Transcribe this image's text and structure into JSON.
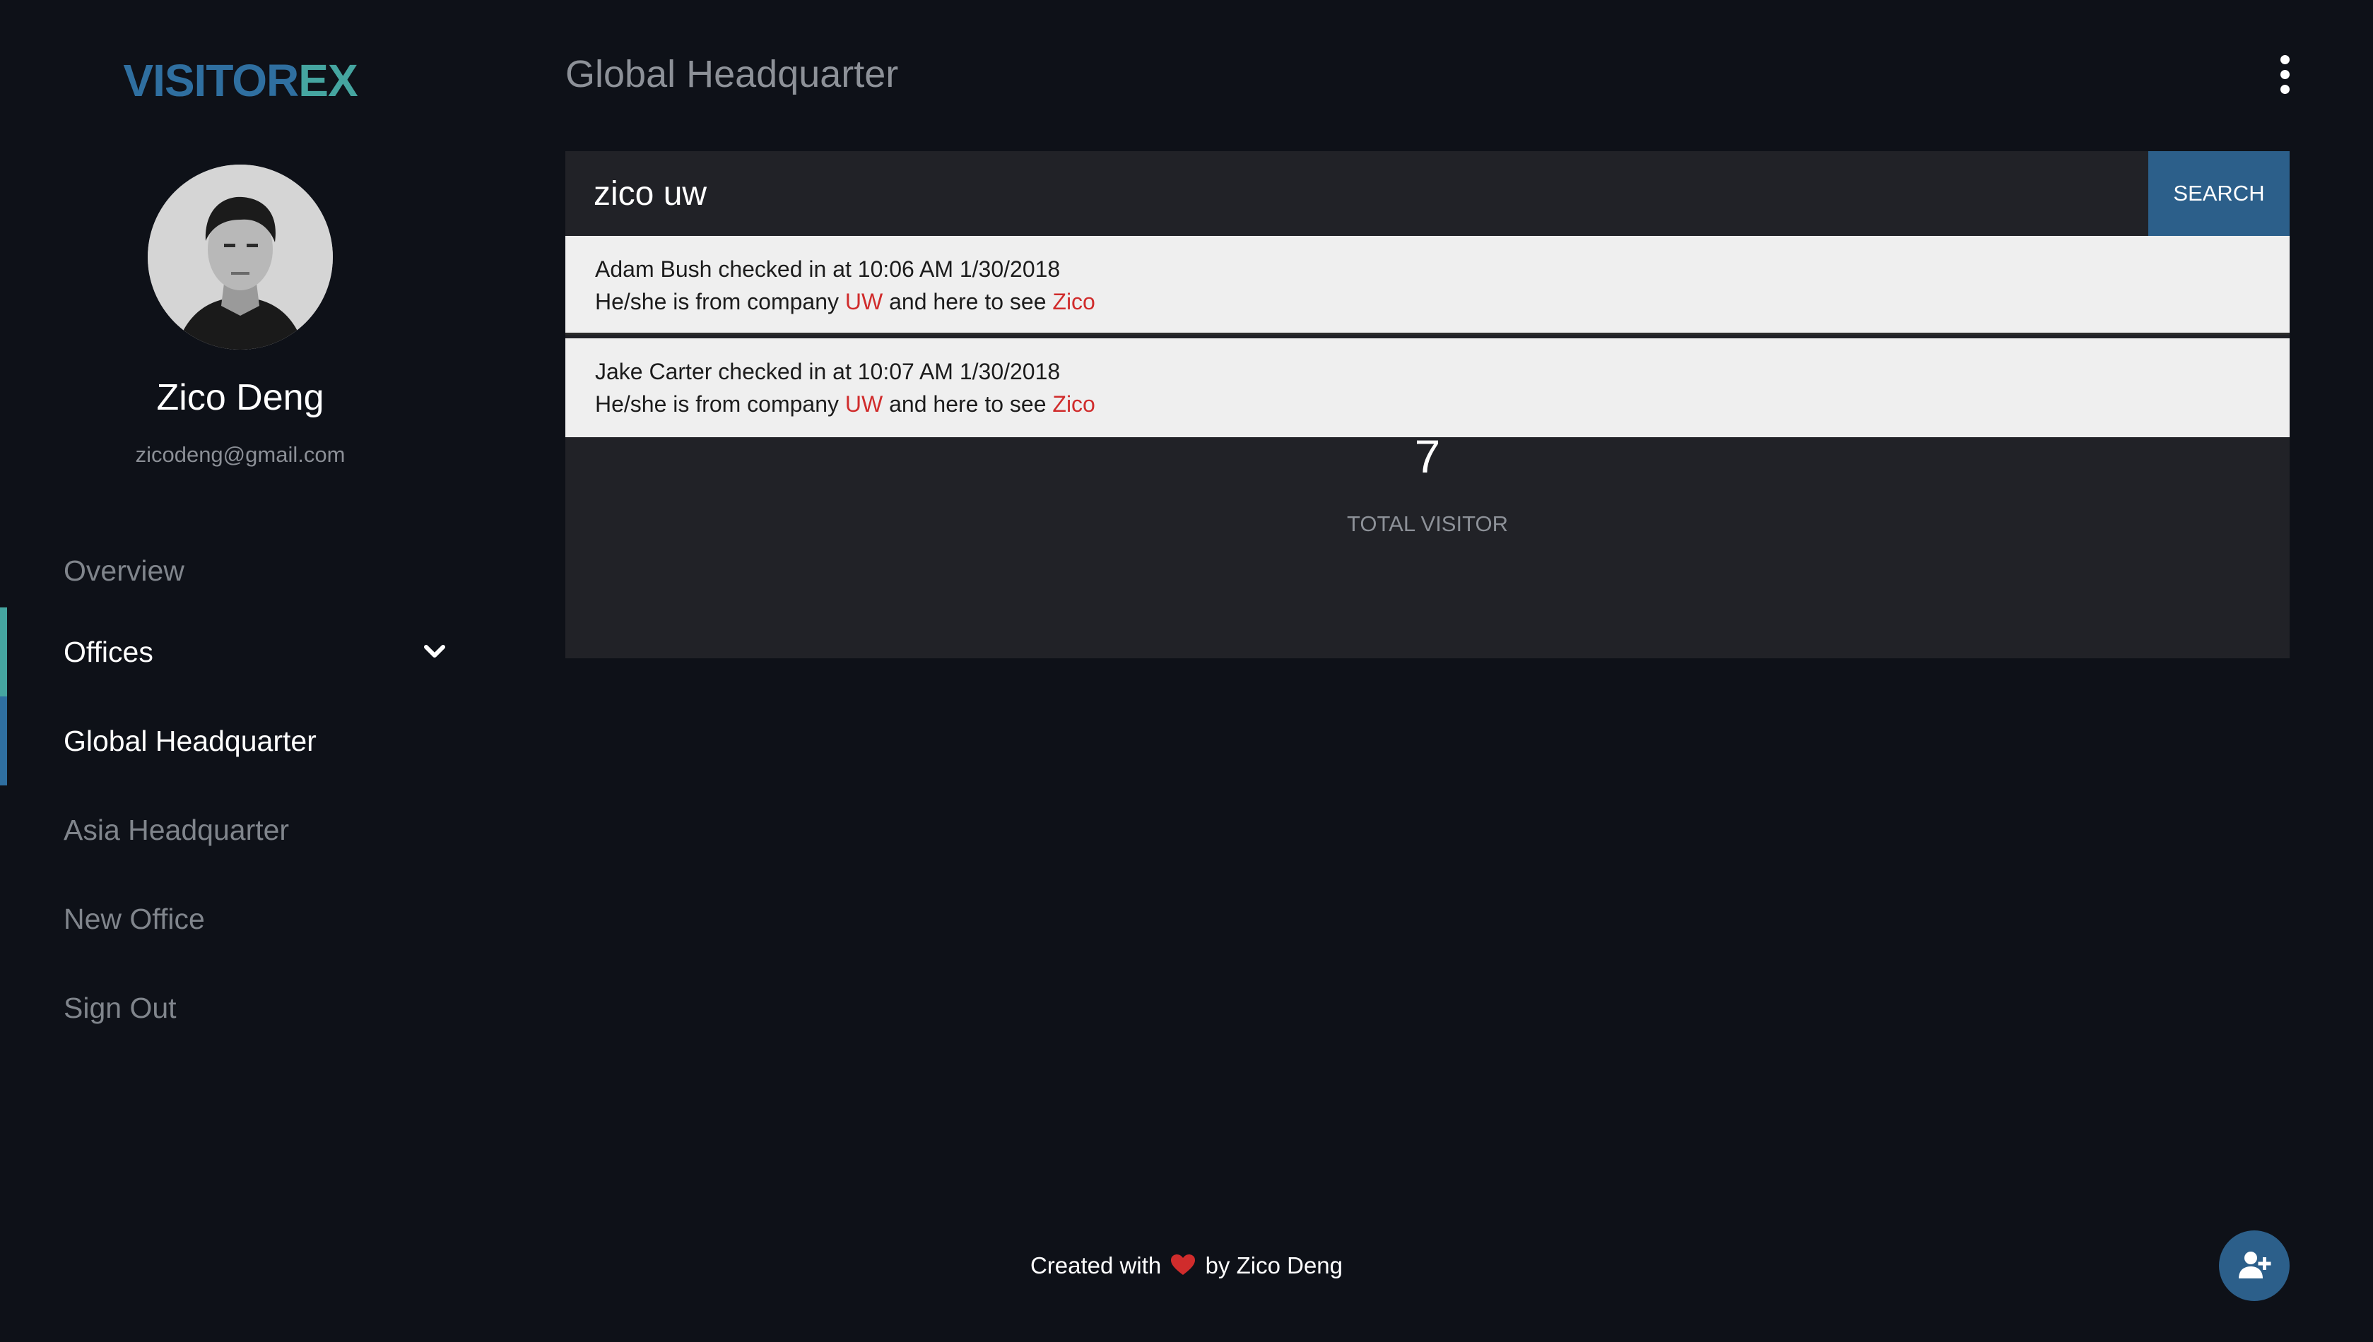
{
  "sidebar": {
    "logo": {
      "part1": "VISITOR",
      "part2": "EX"
    },
    "user": {
      "name": "Zico Deng",
      "email": "zicodeng@gmail.com"
    },
    "nav": {
      "overview": "Overview",
      "offices": "Offices",
      "global_hq": "Global Headquarter",
      "asia_hq": "Asia Headquarter",
      "new_office": "New Office",
      "sign_out": "Sign Out"
    },
    "accent_colors": {
      "offices_bar": "#45a5a0",
      "global_hq_bar": "#2f6fa0"
    }
  },
  "header": {
    "title": "Global Headquarter",
    "menu_icon": "kebab-vertical-icon"
  },
  "search": {
    "value": "zico uw",
    "button_label": "SEARCH"
  },
  "results": [
    {
      "line1": "Adam Bush checked in at 10:06 AM 1/30/2018",
      "prefix": "He/she is from company ",
      "company": "UW",
      "middle": " and here to see ",
      "host": "Zico"
    },
    {
      "line1": "Jake Carter checked in at 10:07 AM 1/30/2018",
      "prefix": "He/she is from company ",
      "company": "UW",
      "middle": " and here to see ",
      "host": "Zico"
    }
  ],
  "stats": {
    "total_visitor_value": "7",
    "total_visitor_label": "TOTAL VISITOR"
  },
  "footer": {
    "prefix": "Created with",
    "suffix": "by Zico Deng",
    "heart_icon": "heart-icon",
    "heart_color": "#d02c2c"
  },
  "fab": {
    "icon": "add-user-icon",
    "color": "#2c5f8a"
  }
}
